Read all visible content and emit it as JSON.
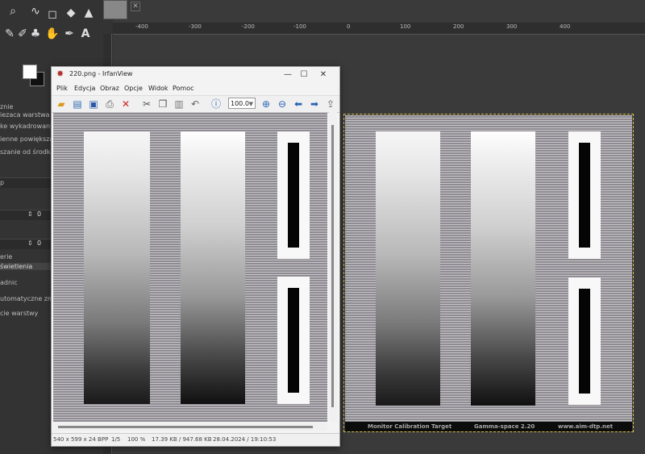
{
  "gimp": {
    "options": [
      "znie",
      "iezaca warstwa",
      "ke wykadrowanych p",
      "ienne powiększania",
      "szanie od środka",
      "p",
      "",
      "0",
      "",
      "0",
      "erie",
      "świetlenia",
      "adnic",
      "utomatyczne zmnie",
      "cie warstwy"
    ],
    "ruler_labels": [
      "-400",
      "-300",
      "-200",
      "-100",
      "0",
      "100",
      "200",
      "300",
      "400"
    ]
  },
  "irfanview": {
    "title": "220.png - IrfanView",
    "menu": [
      "Plik",
      "Edycja",
      "Obraz",
      "Opcje",
      "Widok",
      "Pomoc"
    ],
    "zoom_value": "100.0",
    "status": {
      "dims": "540 x 599 x 24 BPP",
      "page": "1/5",
      "zoom": "100 %",
      "size": "17.39 KB / 947.68 KB",
      "date": "28.04.2024 / 19:10:53"
    }
  },
  "calibration_image": {
    "footer_left": "Monitor Calibration Target",
    "footer_mid": "Gamma-space 2.20",
    "footer_right": "www.aim-dtp.net"
  },
  "colors": {
    "gimp_bg": "#3a3a3a",
    "selection_border": "#d8c04a",
    "window_bg": "#f3f3f3"
  }
}
